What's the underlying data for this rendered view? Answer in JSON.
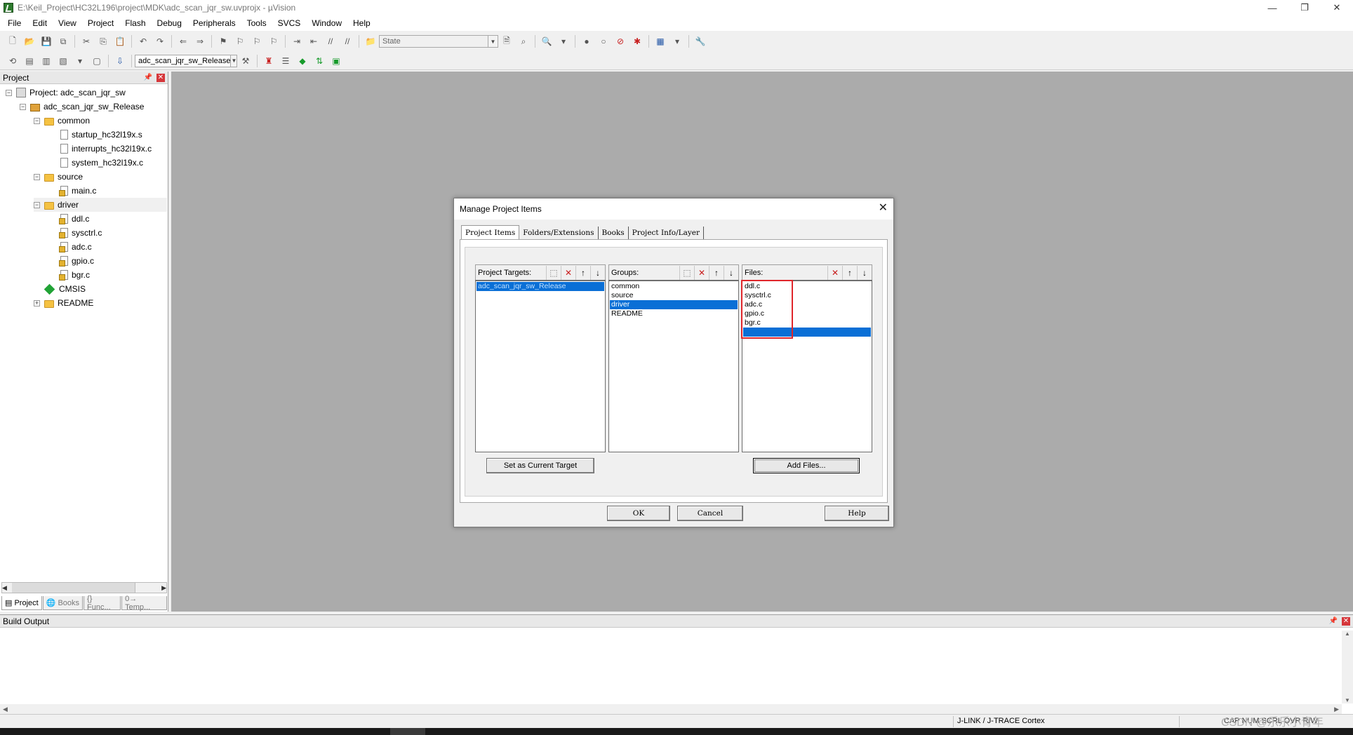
{
  "window": {
    "title": "E:\\Keil_Project\\HC32L196\\project\\MDK\\adc_scan_jqr_sw.uvprojx - µVision",
    "controls": {
      "minimize": "—",
      "restore": "❐",
      "close": "✕"
    }
  },
  "menu": [
    "File",
    "Edit",
    "View",
    "Project",
    "Flash",
    "Debug",
    "Peripherals",
    "Tools",
    "SVCS",
    "Window",
    "Help"
  ],
  "toolbar": {
    "state_combo": "State",
    "target_combo": "adc_scan_jqr_sw_Release"
  },
  "project_panel": {
    "title": "Project",
    "tree": {
      "root": "Project: adc_scan_jqr_sw",
      "target": "adc_scan_jqr_sw_Release",
      "groups": [
        {
          "name": "common",
          "files": [
            "startup_hc32l19x.s",
            "interrupts_hc32l19x.c",
            "system_hc32l19x.c"
          ]
        },
        {
          "name": "source",
          "files": [
            "main.c"
          ]
        },
        {
          "name": "driver",
          "files": [
            "ddl.c",
            "sysctrl.c",
            "adc.c",
            "gpio.c",
            "bgr.c"
          ]
        }
      ],
      "cmsis": "CMSIS",
      "readme": "README"
    },
    "tabs": [
      "Project",
      "Books",
      "{} Func...",
      "0→ Temp..."
    ]
  },
  "build_output": {
    "title": "Build Output"
  },
  "status": {
    "debugger": "J-LINK / J-TRACE Cortex",
    "indicators": "CAP NUM SCRL OVR R/W",
    "watermark": "CSDN @乐乐小青年"
  },
  "dialog": {
    "title": "Manage Project Items",
    "tabs": [
      "Project Items",
      "Folders/Extensions",
      "Books",
      "Project Info/Layer"
    ],
    "targets": {
      "label": "Project Targets:",
      "items": [
        "adc_scan_jqr_sw_Release"
      ]
    },
    "groups": {
      "label": "Groups:",
      "items": [
        "common",
        "source",
        "driver",
        "README"
      ]
    },
    "files": {
      "label": "Files:",
      "items": [
        "ddl.c",
        "sysctrl.c",
        "adc.c",
        "gpio.c",
        "bgr.c"
      ]
    },
    "buttons": {
      "set_target": "Set as Current Target",
      "add_files": "Add Files...",
      "ok": "OK",
      "cancel": "Cancel",
      "help": "Help"
    }
  },
  "colors": {
    "selection": "#0a6fd6",
    "highlight_box": "#e0262b",
    "editor_bg": "#ababab"
  }
}
